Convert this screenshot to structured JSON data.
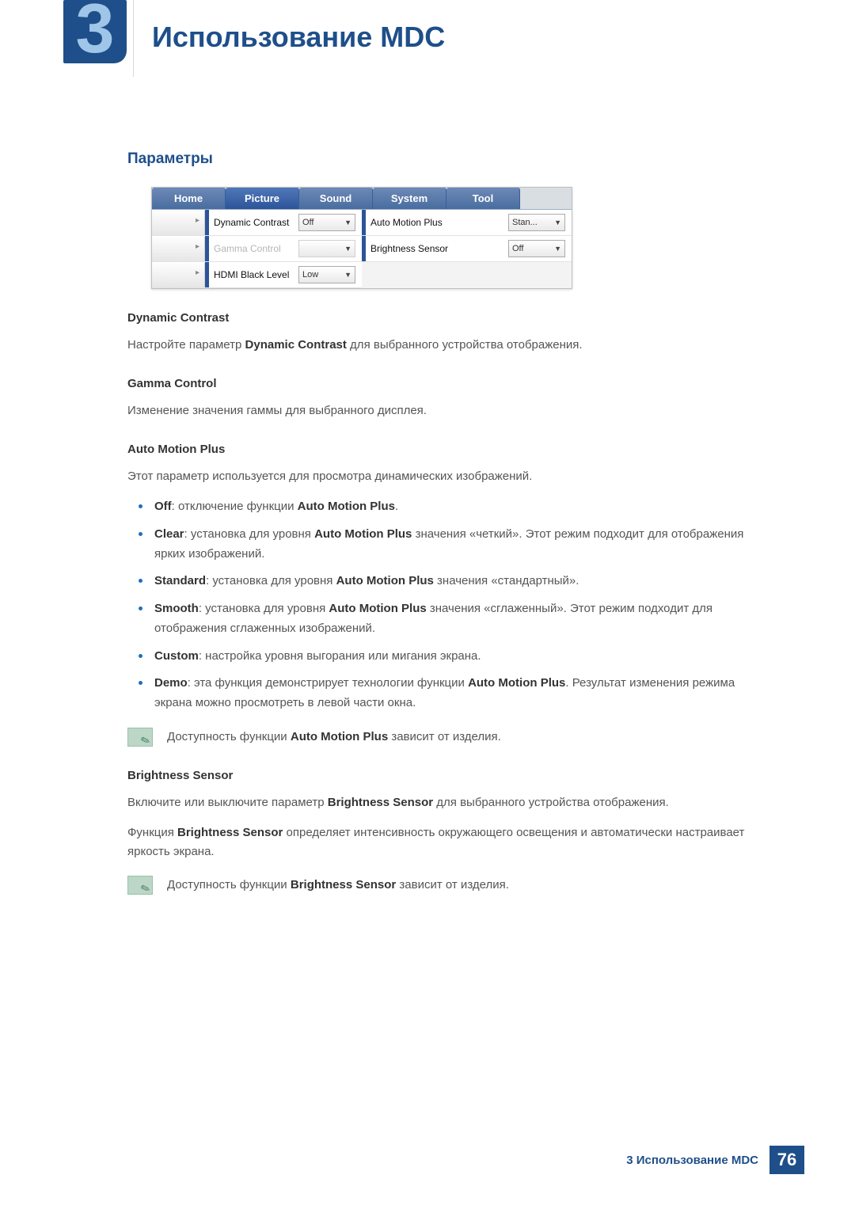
{
  "chapter": {
    "number": "3",
    "title": "Использование MDC"
  },
  "section_title": "Параметры",
  "screenshot": {
    "tabs": [
      "Home",
      "Picture",
      "Sound",
      "System",
      "Tool"
    ],
    "left_rows": [
      {
        "label": "Dynamic Contrast",
        "value": "Off",
        "disabled": false,
        "has_side": true
      },
      {
        "label": "Gamma Control",
        "value": "",
        "disabled": true,
        "has_side": true
      },
      {
        "label": "HDMI Black Level",
        "value": "Low",
        "disabled": false,
        "has_side": true
      }
    ],
    "right_rows": [
      {
        "label": "Auto Motion Plus",
        "value": "Stan..."
      },
      {
        "label": "Brightness Sensor",
        "value": "Off"
      }
    ]
  },
  "sections": {
    "dynamic_contrast": {
      "heading": "Dynamic Contrast",
      "text_pre": "Настройте параметр ",
      "text_bold": "Dynamic Contrast",
      "text_post": " для выбранного устройства отображения."
    },
    "gamma_control": {
      "heading": "Gamma Control",
      "text": "Изменение значения гаммы для выбранного дисплея."
    },
    "auto_motion_plus": {
      "heading": "Auto Motion Plus",
      "intro": "Этот параметр используется для просмотра динамических изображений.",
      "items": [
        {
          "b": "Off",
          "rest": ": отключение функции ",
          "b2": "Auto Motion Plus",
          "rest2": "."
        },
        {
          "b": "Clear",
          "rest": ": установка для уровня ",
          "b2": "Auto Motion Plus",
          "rest2": " значения «четкий». Этот режим подходит для отображения ярких изображений."
        },
        {
          "b": "Standard",
          "rest": ": установка для уровня ",
          "b2": "Auto Motion Plus",
          "rest2": " значения «стандартный»."
        },
        {
          "b": "Smooth",
          "rest": ": установка для уровня ",
          "b2": "Auto Motion Plus",
          "rest2": " значения «сглаженный». Этот режим подходит для отображения сглаженных изображений."
        },
        {
          "b": "Custom",
          "rest": ": настройка уровня выгорания или мигания экрана.",
          "b2": "",
          "rest2": ""
        },
        {
          "b": "Demo",
          "rest": ": эта функция демонстрирует технологии функции ",
          "b2": "Auto Motion Plus",
          "rest2": ". Результат изменения режима экрана можно просмотреть в левой части окна."
        }
      ],
      "note_pre": "Доступность функции ",
      "note_bold": "Auto Motion Plus",
      "note_post": " зависит от изделия."
    },
    "brightness_sensor": {
      "heading": "Brightness Sensor",
      "p1_pre": "Включите или выключите параметр ",
      "p1_bold": "Brightness Sensor",
      "p1_post": " для выбранного устройства отображения.",
      "p2_pre": "Функция ",
      "p2_bold": "Brightness Sensor",
      "p2_post": " определяет интенсивность окружающего освещения и автоматически настраивает яркость экрана.",
      "note_pre": "Доступность функции ",
      "note_bold": "Brightness Sensor",
      "note_post": " зависит от изделия."
    }
  },
  "footer": {
    "label": "3 Использование MDC",
    "page": "76"
  }
}
